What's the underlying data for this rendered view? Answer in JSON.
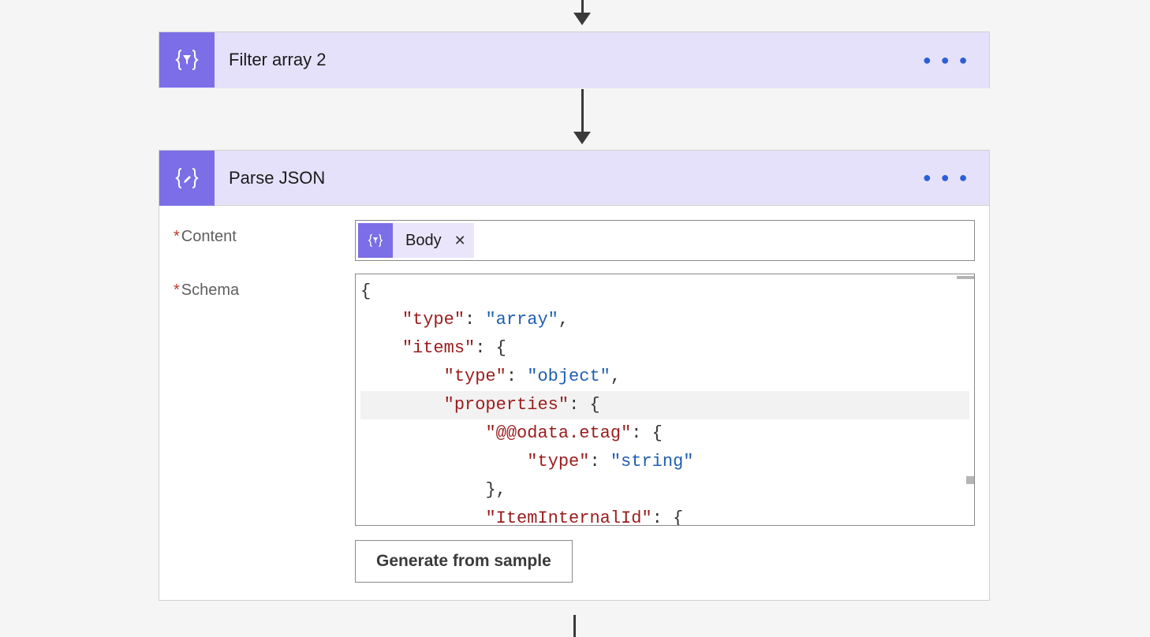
{
  "steps": {
    "filter_array": {
      "title": "Filter array 2",
      "icon": "braces-funnel"
    },
    "parse_json": {
      "title": "Parse JSON",
      "icon": "braces-pencil",
      "fields": {
        "content": {
          "label": "Content",
          "required": true,
          "token": {
            "label": "Body",
            "icon": "braces-funnel"
          }
        },
        "schema": {
          "label": "Schema",
          "required": true,
          "code_lines": [
            {
              "tokens": [
                {
                  "t": "punc",
                  "v": "{"
                }
              ]
            },
            {
              "tokens": [
                {
                  "t": "indent",
                  "n": 1
                },
                {
                  "t": "key",
                  "v": "\"type\""
                },
                {
                  "t": "punc",
                  "v": ": "
                },
                {
                  "t": "str",
                  "v": "\"array\""
                },
                {
                  "t": "punc",
                  "v": ","
                }
              ]
            },
            {
              "tokens": [
                {
                  "t": "indent",
                  "n": 1
                },
                {
                  "t": "key",
                  "v": "\"items\""
                },
                {
                  "t": "punc",
                  "v": ": {"
                }
              ]
            },
            {
              "tokens": [
                {
                  "t": "indent",
                  "n": 2
                },
                {
                  "t": "key",
                  "v": "\"type\""
                },
                {
                  "t": "punc",
                  "v": ": "
                },
                {
                  "t": "str",
                  "v": "\"object\""
                },
                {
                  "t": "punc",
                  "v": ","
                }
              ]
            },
            {
              "highlight": true,
              "tokens": [
                {
                  "t": "indent",
                  "n": 2
                },
                {
                  "t": "key",
                  "v": "\"properties\""
                },
                {
                  "t": "punc",
                  "v": ": {"
                }
              ]
            },
            {
              "tokens": [
                {
                  "t": "indent",
                  "n": 3
                },
                {
                  "t": "key",
                  "v": "\"@@odata.etag\""
                },
                {
                  "t": "punc",
                  "v": ": {"
                }
              ]
            },
            {
              "tokens": [
                {
                  "t": "indent",
                  "n": 4
                },
                {
                  "t": "key",
                  "v": "\"type\""
                },
                {
                  "t": "punc",
                  "v": ": "
                },
                {
                  "t": "str",
                  "v": "\"string\""
                }
              ]
            },
            {
              "tokens": [
                {
                  "t": "indent",
                  "n": 3
                },
                {
                  "t": "punc",
                  "v": "},"
                }
              ]
            },
            {
              "tokens": [
                {
                  "t": "indent",
                  "n": 3
                },
                {
                  "t": "key",
                  "v": "\"ItemInternalId\""
                },
                {
                  "t": "punc",
                  "v": ": {"
                }
              ]
            }
          ]
        }
      },
      "generate_button": "Generate from sample"
    }
  },
  "menu_dots": "● ● ●"
}
